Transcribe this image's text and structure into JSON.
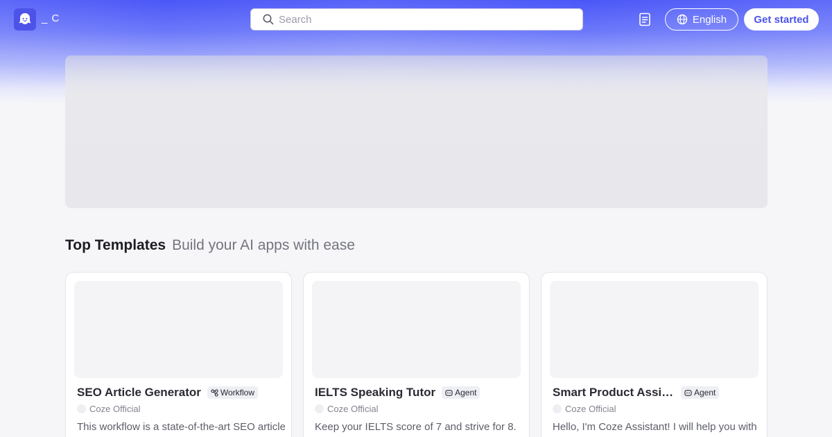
{
  "header": {
    "logo_text": "_ C",
    "search": {
      "placeholder": "Search",
      "icon": "search-icon"
    },
    "docs_icon": "document-icon",
    "language_button": {
      "label": "English",
      "icon": "globe-icon"
    },
    "get_started_label": "Get started"
  },
  "section": {
    "title": "Top Templates",
    "subtitle": "Build your AI apps with ease"
  },
  "cards": [
    {
      "title": "SEO Article Generator",
      "badge": "Workflow",
      "badge_icon": "workflow-icon",
      "author": "Coze Official",
      "description": "This workflow is a state-of-the-art SEO article"
    },
    {
      "title": "IELTS Speaking Tutor",
      "badge": "Agent",
      "badge_icon": "agent-icon",
      "author": "Coze Official",
      "description": "Keep your IELTS score of 7 and strive for 8."
    },
    {
      "title": "Smart Product Assistant",
      "badge": "Agent",
      "badge_icon": "agent-icon",
      "author": "Coze Official",
      "description": "Hello, I'm Coze Assistant! I will help you with"
    }
  ],
  "colors": {
    "brand": "#4d53e8",
    "hero_gradient_top": "#4a57f7",
    "page_background": "#f6f6f8"
  }
}
